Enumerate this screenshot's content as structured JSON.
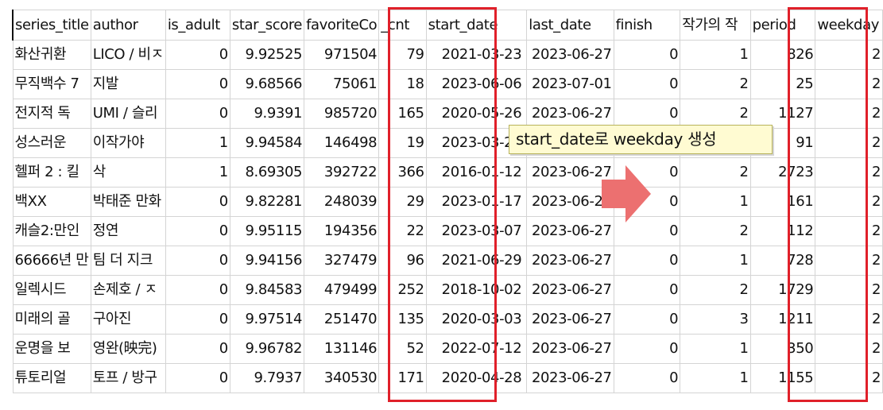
{
  "columns": [
    "series_title",
    "author",
    "is_adult",
    "star_score",
    "favoriteCo",
    "_cnt",
    "start_date",
    "last_date",
    "finish",
    "작가의 작",
    "period",
    "weekday"
  ],
  "rows": [
    [
      "화산귀환",
      "LICO / 비ㅈ",
      "0",
      "9.92525",
      "971504",
      "79",
      "2021-03-23",
      "2023-06-27",
      "0",
      "1",
      "826",
      "2"
    ],
    [
      "무직백수 7",
      "지발",
      "0",
      "9.68566",
      "75061",
      "18",
      "2023-06-06",
      "2023-07-01",
      "0",
      "2",
      "25",
      "2"
    ],
    [
      "전지적 독",
      "UMI / 슬리",
      "0",
      "9.9391",
      "985720",
      "165",
      "2020-05-26",
      "2023-06-27",
      "0",
      "2",
      "1127",
      "2"
    ],
    [
      "성스러운 ",
      "이작가야",
      "1",
      "9.94584",
      "146498",
      "19",
      "2023-03-28",
      "2",
      "",
      "",
      "91",
      "2"
    ],
    [
      "헬퍼 2 : 킬",
      "삭",
      "1",
      "8.69305",
      "392722",
      "366",
      "2016-01-12",
      "2023-06-27",
      "0",
      "2",
      "2723",
      "2"
    ],
    [
      "백XX",
      "박태준 만화",
      "0",
      "9.82281",
      "248039",
      "29",
      "2023-01-17",
      "2023-06-27",
      "0",
      "1",
      "161",
      "2"
    ],
    [
      "캐슬2:만인",
      "정연",
      "0",
      "9.95115",
      "194356",
      "22",
      "2023-03-07",
      "2023-06-27",
      "0",
      "2",
      "112",
      "2"
    ],
    [
      "66666년 만",
      "팀 더 지크",
      "0",
      "9.94156",
      "327479",
      "96",
      "2021-06-29",
      "2023-06-27",
      "0",
      "1",
      "728",
      "2"
    ],
    [
      "일렉시드",
      "손제호 / ㅈ",
      "0",
      "9.84583",
      "479499",
      "252",
      "2018-10-02",
      "2023-06-27",
      "0",
      "2",
      "1729",
      "2"
    ],
    [
      "미래의 골",
      "구아진",
      "0",
      "9.97514",
      "251470",
      "135",
      "2020-03-03",
      "2023-06-27",
      "0",
      "3",
      "1211",
      "2"
    ],
    [
      "운명을 보",
      "영완(映完)",
      "0",
      "9.96782",
      "131146",
      "52",
      "2022-07-12",
      "2023-06-27",
      "0",
      "1",
      "350",
      "2"
    ],
    [
      "튜토리얼 ",
      "토프 / 방구",
      "0",
      "9.7937",
      "340530",
      "171",
      "2020-04-28",
      "2023-06-27",
      "0",
      "1",
      "1155",
      "2"
    ]
  ],
  "annotation": {
    "text": "start_date로 weekday 생성",
    "highlight_color": "#e0202a",
    "arrow_color": "#ec7070",
    "callout_bg": "#fffbd2",
    "arrow_icon": "arrow-right-icon"
  }
}
